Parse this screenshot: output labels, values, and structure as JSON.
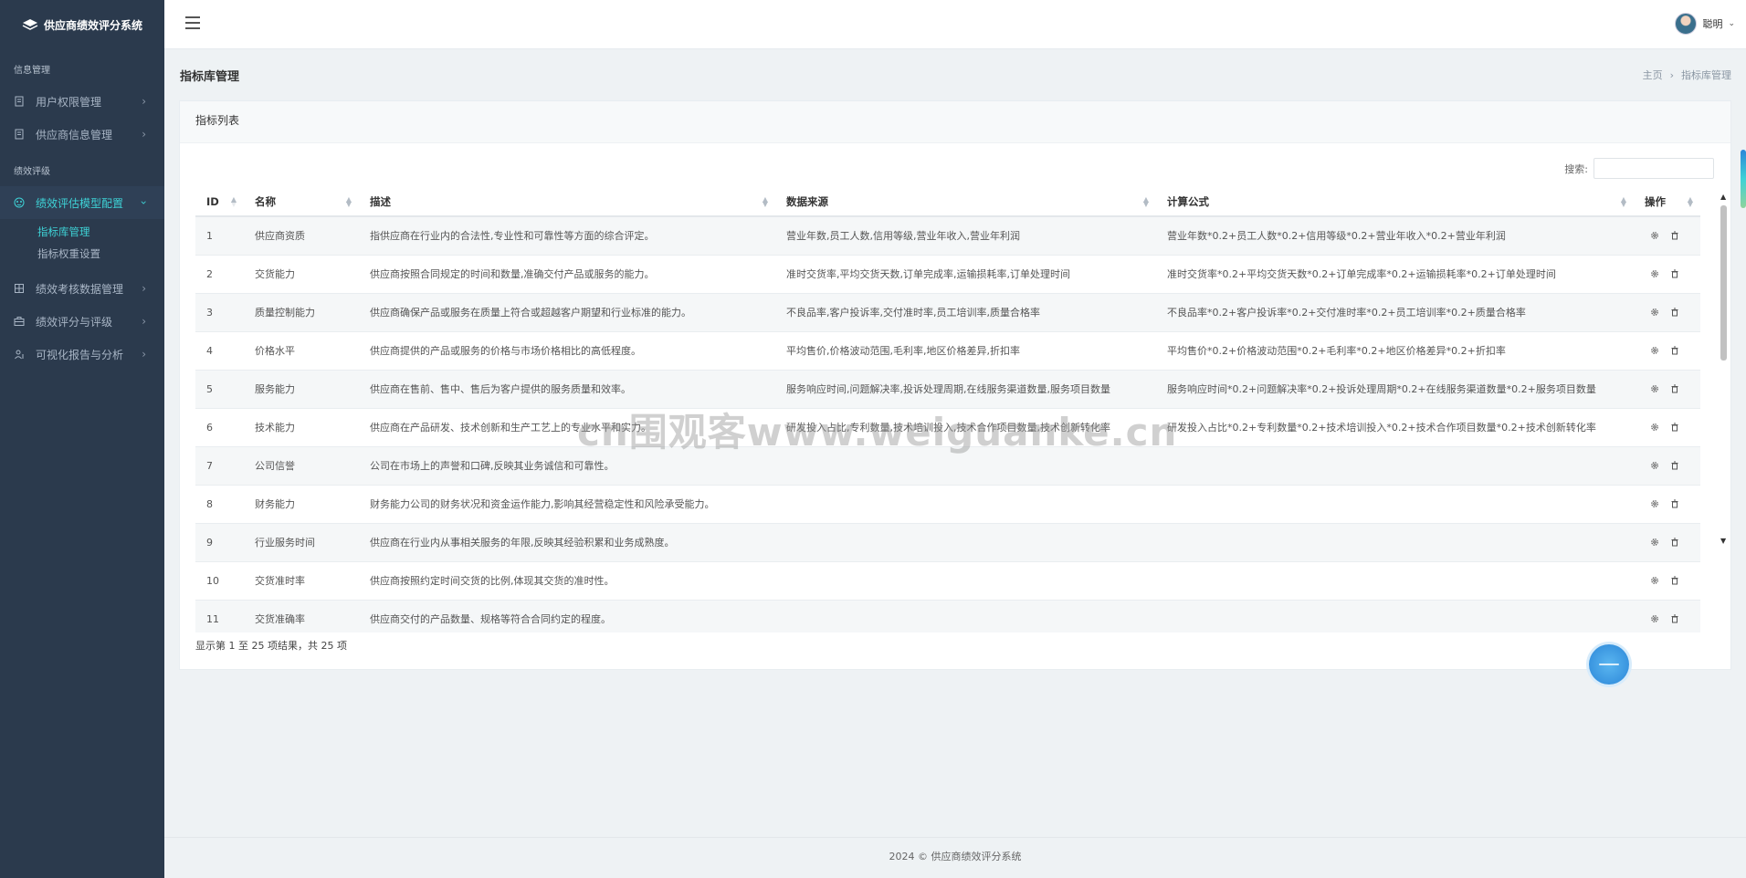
{
  "app": {
    "title": "供应商绩效评分系统"
  },
  "sidebar": {
    "sections": [
      {
        "title": "信息管理",
        "items": [
          {
            "label": "用户权限管理",
            "icon": "document-icon"
          },
          {
            "label": "供应商信息管理",
            "icon": "document-icon"
          }
        ]
      },
      {
        "title": "绩效评级",
        "items": [
          {
            "label": "绩效评估模型配置",
            "icon": "palette-icon",
            "active": true,
            "children": [
              {
                "label": "指标库管理",
                "active": true
              },
              {
                "label": "指标权重设置"
              }
            ]
          },
          {
            "label": "绩效考核数据管理",
            "icon": "grid-icon"
          },
          {
            "label": "绩效评分与评级",
            "icon": "briefcase-icon"
          },
          {
            "label": "可视化报告与分析",
            "icon": "user-chart-icon"
          }
        ]
      }
    ]
  },
  "topbar": {
    "user_name": "聪明"
  },
  "page": {
    "title": "指标库管理",
    "breadcrumb": [
      "主页",
      "指标库管理"
    ]
  },
  "card": {
    "title": "指标列表",
    "search_label": "搜索:",
    "search_value": "",
    "columns": [
      "ID",
      "名称",
      "描述",
      "数据来源",
      "计算公式",
      "操作"
    ],
    "rows": [
      [
        "1",
        "供应商资质",
        "指供应商在行业内的合法性,专业性和可靠性等方面的综合评定。",
        "营业年数,员工人数,信用等级,营业年收入,营业年利润",
        "营业年数*0.2+员工人数*0.2+信用等级*0.2+营业年收入*0.2+营业年利润"
      ],
      [
        "2",
        "交货能力",
        "供应商按照合同规定的时间和数量,准确交付产品或服务的能力。",
        "准时交货率,平均交货天数,订单完成率,运输损耗率,订单处理时间",
        "准时交货率*0.2+平均交货天数*0.2+订单完成率*0.2+运输损耗率*0.2+订单处理时间"
      ],
      [
        "3",
        "质量控制能力",
        "供应商确保产品或服务在质量上符合或超越客户期望和行业标准的能力。",
        "不良品率,客户投诉率,交付准时率,员工培训率,质量合格率",
        "不良品率*0.2+客户投诉率*0.2+交付准时率*0.2+员工培训率*0.2+质量合格率"
      ],
      [
        "4",
        "价格水平",
        "供应商提供的产品或服务的价格与市场价格相比的高低程度。",
        "平均售价,价格波动范围,毛利率,地区价格差异,折扣率",
        "平均售价*0.2+价格波动范围*0.2+毛利率*0.2+地区价格差异*0.2+折扣率"
      ],
      [
        "5",
        "服务能力",
        "供应商在售前、售中、售后为客户提供的服务质量和效率。",
        "服务响应时间,问题解决率,投诉处理周期,在线服务渠道数量,服务项目数量",
        "服务响应时间*0.2+问题解决率*0.2+投诉处理周期*0.2+在线服务渠道数量*0.2+服务项目数量"
      ],
      [
        "6",
        "技术能力",
        "供应商在产品研发、技术创新和生产工艺上的专业水平和实力。",
        "研发投入占比,专利数量,技术培训投入,技术合作项目数量,技术创新转化率",
        "研发投入占比*0.2+专利数量*0.2+技术培训投入*0.2+技术合作项目数量*0.2+技术创新转化率"
      ],
      [
        "7",
        "公司信誉",
        "公司在市场上的声誉和口碑,反映其业务诚信和可靠性。",
        "",
        ""
      ],
      [
        "8",
        "财务能力",
        "财务能力公司的财务状况和资金运作能力,影响其经营稳定性和风险承受能力。",
        "",
        ""
      ],
      [
        "9",
        "行业服务时间",
        "供应商在行业内从事相关服务的年限,反映其经验积累和业务成熟度。",
        "",
        ""
      ],
      [
        "10",
        "交货准时率",
        "供应商按照约定时间交货的比例,体现其交货的准时性。",
        "",
        ""
      ],
      [
        "11",
        "交货准确率",
        "供应商交付的产品数量、规格等符合合同约定的程度。",
        "",
        ""
      ]
    ],
    "info": "显示第 1 至 25 项结果，共 25 项"
  },
  "watermark": "cn围观客www.weiguanke.cn",
  "footer": "2024 © 供应商绩效评分系统"
}
